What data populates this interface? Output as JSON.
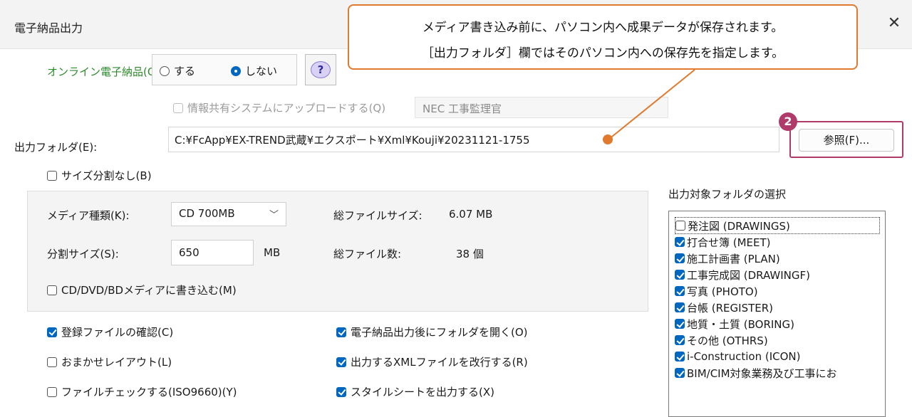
{
  "window": {
    "title": "電子納品出力",
    "close_glyph": "✕"
  },
  "callout": {
    "line1": "メディア書き込み前に、パソコン内へ成果データが保存されます。",
    "line2": "［出力フォルダ］欄ではそのパソコン内への保存先を指定します。",
    "accent_color": "#e07a2e"
  },
  "online": {
    "label": "オンライン電子納品(G)",
    "options": [
      {
        "label": "する",
        "selected": false
      },
      {
        "label": "しない",
        "selected": true
      }
    ],
    "help_glyph": "?"
  },
  "share_upload": {
    "label": "情報共有システムにアップロードする(Q)",
    "checked": false,
    "enabled": false,
    "system_value": "NEC 工事監理官"
  },
  "output_folder": {
    "label": "出力フォルダ(E):",
    "path": "C:¥FcApp¥EX-TREND武蔵¥エクスポート¥Xml¥Kouji¥20231121-1755",
    "browse_label": "参照(F)...",
    "step_badge": "2",
    "badge_color": "#b03a6a"
  },
  "no_size_split": {
    "label": "サイズ分割なし(B)",
    "checked": false
  },
  "media": {
    "type_label": "メディア種類(K):",
    "type_value": "CD  700MB",
    "split_label": "分割サイズ(S):",
    "split_value": "650",
    "split_unit": "MB",
    "total_size_label": "総ファイルサイズ:",
    "total_size_value": "6.07 MB",
    "total_count_label": "総ファイル数:",
    "total_count_value": "38 個",
    "write_media_label": "CD/DVD/BDメディアに書き込む(M)",
    "write_media_checked": false
  },
  "options_left": [
    {
      "label": "登録ファイルの確認(C)",
      "checked": true
    },
    {
      "label": "おまかせレイアウト(L)",
      "checked": false
    },
    {
      "label": "ファイルチェックする(ISO9660)(Y)",
      "checked": false
    }
  ],
  "options_right": [
    {
      "label": "電子納品出力後にフォルダを開く(O)",
      "checked": true
    },
    {
      "label": "出力するXMLファイルを改行する(R)",
      "checked": true
    },
    {
      "label": "スタイルシートを出力する(X)",
      "checked": true
    }
  ],
  "folder_select": {
    "label": "出力対象フォルダの選択",
    "items": [
      {
        "label": "発注図 (DRAWINGS)",
        "checked": false
      },
      {
        "label": "打合せ簿 (MEET)",
        "checked": true
      },
      {
        "label": "施工計画書 (PLAN)",
        "checked": true
      },
      {
        "label": "工事完成図 (DRAWINGF)",
        "checked": true
      },
      {
        "label": "写真 (PHOTO)",
        "checked": true
      },
      {
        "label": "台帳 (REGISTER)",
        "checked": true
      },
      {
        "label": "地質・土質 (BORING)",
        "checked": true
      },
      {
        "label": "その他 (OTHRS)",
        "checked": true
      },
      {
        "label": "i-Construction (ICON)",
        "checked": true
      },
      {
        "label": "BIM/CIM対象業務及び工事にお",
        "checked": true
      }
    ]
  }
}
